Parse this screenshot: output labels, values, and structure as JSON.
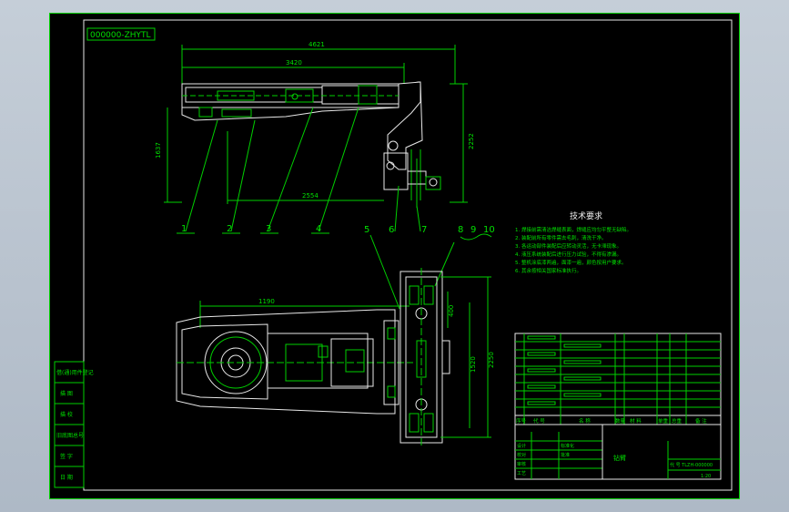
{
  "drawing": {
    "code": "000000-ZHYTL",
    "dimensions": {
      "overall_length": "4621",
      "boom_length": "3420",
      "height_left": "1637",
      "height_right": "2252",
      "bottom_length": "2554",
      "plan_length": "1190",
      "right_a": "400",
      "right_b": "1520",
      "right_c": "2250"
    },
    "callouts": [
      "1",
      "2",
      "3",
      "4",
      "5",
      "6",
      "7",
      "8",
      "9",
      "10"
    ],
    "tech_title": "技术要求",
    "tech_lines": [
      "1. 焊接前需清洁焊缝表面，焊缝应均匀平整无缺陷。",
      "2. 装配前所有零件需去毛刺，清洗干净。",
      "3. 各运动部件装配后应转动灵活，无卡滞现象。",
      "4. 液压系统装配后进行压力试验，不得有渗漏。",
      "5. 整机涂底漆两遍，面漆一遍，颜色按用户要求。",
      "6. 其余按相关国家标准执行。"
    ],
    "left_panel": [
      "借(通)用件登记",
      "描 图",
      "描 校",
      "旧底图总号",
      "签 字",
      "日 期"
    ],
    "bom_header": [
      "序号",
      "代 号",
      "名 称",
      "数量",
      "材 料",
      "单重",
      "总重",
      "备 注"
    ],
    "title_block": {
      "name": "钻臂",
      "code": "代 号 TLZH-000000",
      "scale": "1:20",
      "labels": [
        "设计",
        "校对",
        "审核",
        "工艺",
        "标准化",
        "批准"
      ]
    }
  }
}
